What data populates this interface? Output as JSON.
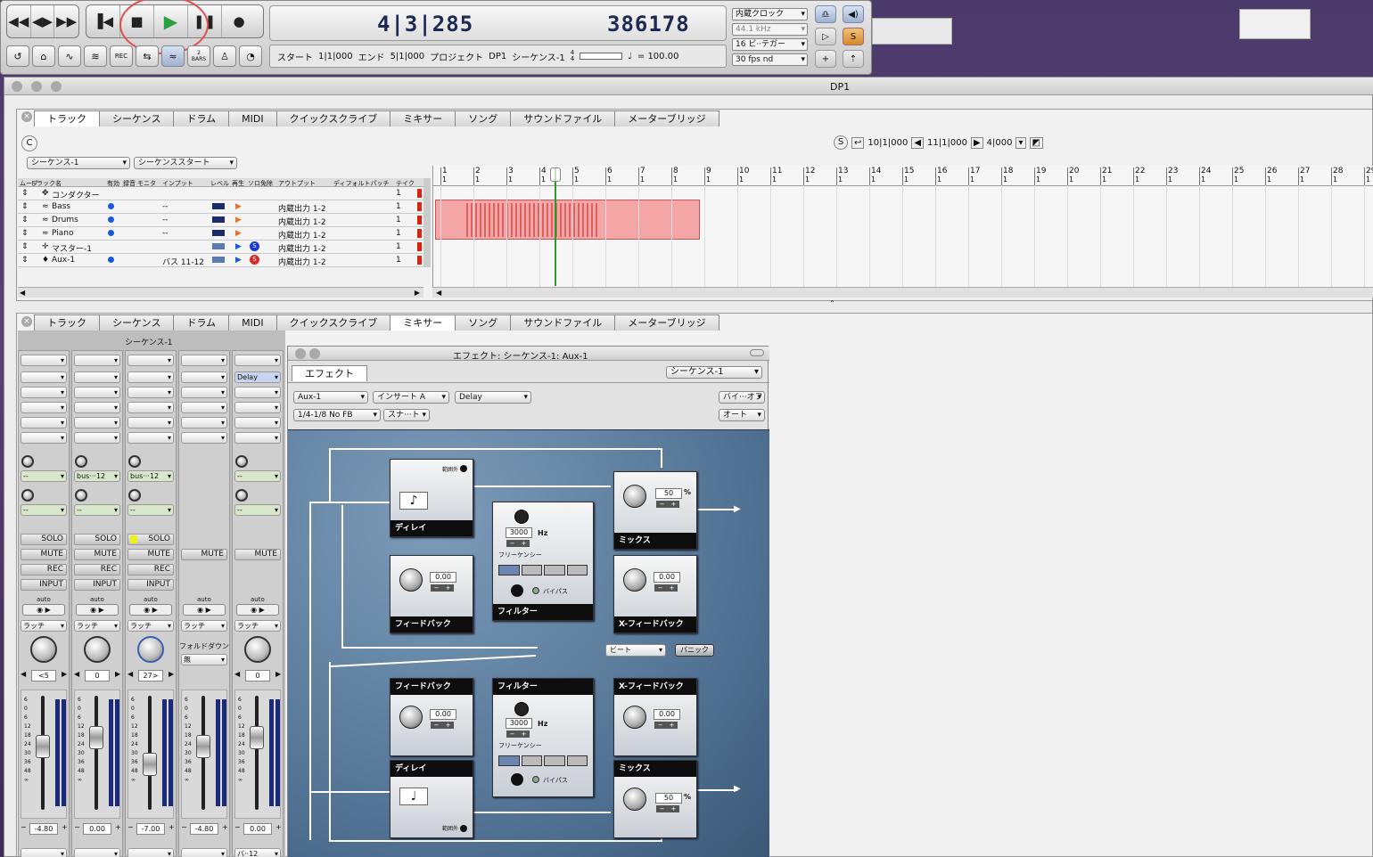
{
  "transport": {
    "time_main": "4|3|285",
    "time_samples": "386178",
    "start_label": "スタート",
    "start_value": "1|1|000",
    "end_label": "エンド",
    "end_value": "5|1|000",
    "project_label": "プロジェクト",
    "project_value": "DP1",
    "sequence": "シーケンス-1",
    "meter_top": "4",
    "meter_bottom": "4",
    "tempo": "= 100.00",
    "clock": "内蔵クロック",
    "rate": "44.1 kHz",
    "bits": "16 ビ··テガー",
    "fps": "30 fps nd",
    "bars_label": "2 BARS",
    "rec_label": "REC",
    "s_button": "S"
  },
  "main_window": {
    "title": "DP1"
  },
  "tabs": [
    "トラック",
    "シーケンス",
    "ドラム",
    "MIDI",
    "クイックスクライブ",
    "ミキサー",
    "ソング",
    "サウンドファイル",
    "メーターブリッジ"
  ],
  "tracks_panel": {
    "c_button": "C",
    "sequence_select": "シーケンス-1",
    "start_select": "シーケンススタート",
    "s_button": "S",
    "loc_start": "10|1|000",
    "loc_end": "11|1|000",
    "loc_len": "4|000",
    "columns": [
      "ムーブ",
      "トラック名",
      "有効",
      "録音",
      "モニタ",
      "インプット",
      "レベル",
      "再生",
      "ソロ免除",
      "アウトプット",
      "ディフォルトパッチ",
      "テイク"
    ],
    "rows": [
      {
        "name": "コンダクター",
        "input": "",
        "output": "",
        "take": "1",
        "icon": "conductor-icon"
      },
      {
        "name": "Bass",
        "input": "--",
        "output": "内蔵出力 1-2",
        "take": "1",
        "icon": "audio-icon"
      },
      {
        "name": "Drums",
        "input": "--",
        "output": "内蔵出力 1-2",
        "take": "1",
        "icon": "audio-icon"
      },
      {
        "name": "Piano",
        "input": "--",
        "output": "内蔵出力 1-2",
        "take": "1",
        "icon": "audio-icon"
      },
      {
        "name": "マスター-1",
        "input": "",
        "output": "内蔵出力 1-2",
        "take": "1",
        "icon": "master-icon"
      },
      {
        "name": "Aux-1",
        "input": "バス 11-12",
        "output": "内蔵出力 1-2",
        "take": "1",
        "icon": "aux-icon"
      }
    ],
    "bars": [
      "1",
      "2",
      "3",
      "4",
      "5",
      "6",
      "7",
      "8",
      "9",
      "10",
      "11",
      "12",
      "13",
      "14",
      "15",
      "16",
      "17",
      "18",
      "19",
      "20",
      "21",
      "22",
      "23",
      "24",
      "25",
      "26",
      "27",
      "28",
      "29"
    ],
    "bar_sub": "1"
  },
  "mixer": {
    "sequence_label": "シーケンス-1",
    "strips": [
      {
        "insert1": "",
        "send1": "--",
        "send2": "--",
        "solo": "SOLO",
        "mute": "MUTE",
        "rec": "REC",
        "input": "INPUT",
        "auto": "auto",
        "mode": "ラッチ",
        "pan": "<5",
        "vol": "-4.80",
        "knob_color": "#333"
      },
      {
        "insert1": "",
        "send1": "bus···12",
        "send2": "--",
        "solo": "SOLO",
        "mute": "MUTE",
        "rec": "REC",
        "input": "INPUT",
        "auto": "auto",
        "mode": "ラッチ",
        "pan": "0",
        "vol": "0.00",
        "knob_color": "#333"
      },
      {
        "insert1": "",
        "send1": "bus···12",
        "send2": "--",
        "solo": "SOLO",
        "mute": "MUTE",
        "rec": "REC",
        "input": "INPUT",
        "auto": "auto",
        "mode": "ラッチ",
        "pan": "27>",
        "vol": "-7.00",
        "knob_color": "#3a5fb0"
      },
      {
        "insert1": "",
        "send1": "",
        "send2": "",
        "solo": "",
        "mute": "MUTE",
        "rec": "",
        "input": "",
        "auto": "auto",
        "mode": "ラッチ",
        "pan": "",
        "vol": "-4.80",
        "knob_color": "#333",
        "fold": "フォルドダウン",
        "fold_val": "無"
      },
      {
        "insert1": "Delay",
        "send1": "--",
        "send2": "--",
        "solo": "",
        "mute": "MUTE",
        "rec": "",
        "input": "",
        "auto": "auto",
        "mode": "ラッチ",
        "pan": "0",
        "vol": "0.00",
        "knob_color": "#333",
        "bottom": "バ··12"
      }
    ]
  },
  "effects": {
    "title": "エフェクト: シーケンス-1: Aux-1",
    "tab": "エフェクト",
    "sequence": "シーケンス-1",
    "track_select": "Aux-1",
    "insert_select": "インサート A",
    "plugin_select": "Delay",
    "bypass_button": "バイ···オフ",
    "preset_select": "1/4-1/8 No FB",
    "snapshot_button": "スナ···ト",
    "auto_select": "オート",
    "top": {
      "delay_label": "ディレイ",
      "range_label": "範囲外",
      "mix_label": "ミックス",
      "mix_value": "50",
      "mix_unit": "%",
      "feedback_label": "フィードバック",
      "feedback_value": "0.00",
      "filter_label": "フィルター",
      "freq_value": "3000",
      "freq_unit": "Hz",
      "freq_label": "フリーケンシー",
      "bypass_label": "バイパス",
      "xfb_label": "X-フィードバック",
      "xfb_value": "0.00"
    },
    "beat_select": "ビート",
    "panic_button": "パニック",
    "bottom": {
      "feedback_label": "フィードバック",
      "feedback_value": "0.00",
      "filter_label": "フィルター",
      "freq_value": "3000",
      "freq_unit": "Hz",
      "freq_label": "フリーケンシー",
      "bypass_label": "バイパス",
      "xfb_label": "X-フィードバック",
      "xfb_value": "0.00",
      "delay_label": "ディレイ",
      "range_label": "範囲外",
      "mix_label": "ミックス",
      "mix_value": "50",
      "mix_unit": "%"
    }
  },
  "colors": {
    "counter_text": "#1c2a54",
    "fx_panel": "#4e6f90",
    "region": "#f4a6a6",
    "playhead": "#2a9a2a",
    "highlight_circle": "#e05050"
  }
}
